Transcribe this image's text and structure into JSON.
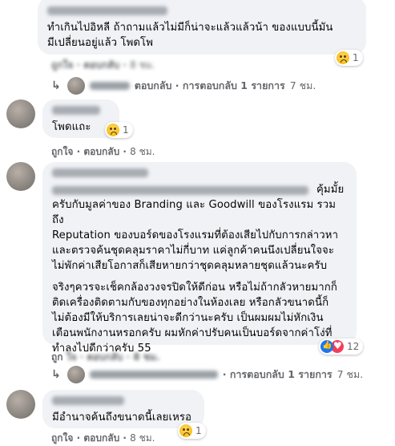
{
  "comments": [
    {
      "text": "ทำเกินไปอิหลี ถ้าถามแล้วไม่มีก็น่าจะแล้วแล้วน้า ของแบบนี้มัน\nมีเปลี่ยนอยู่แล้ว โพดโพ",
      "reaction_count": "1",
      "actions": {
        "like": "ถูกใจ",
        "reply": "ตอบกลับ",
        "time": "8 ชม."
      },
      "reply_summary": {
        "label": "ตอบกลับ · การตอบกลับ 1 รายการ",
        "time": "7 ชม."
      }
    },
    {
      "text": "โพดแถะ",
      "reaction_count": "1",
      "actions": {
        "like": "ถูกใจ",
        "reply": "ตอบกลับ",
        "time": "8 ชม."
      }
    },
    {
      "text_first_line_end": "คุ้มมั้ย",
      "text": "ครับกับมูลค่าของ Branding และ Goodwill ของโรงแรม รวมถึง\nReputation ของบอร์ดของโรงแรมที่ต้องเสียไปกับการกล่าวหา\nและตรวจค้นชุดคลุมราคาไม่กี่บาท แค่ลูกค้าคนนึงเปลี่ยนใจจะ\nไม่พักค่าเสียโอกาสก็เสียหายกว่าชุดคลุมหลายชุดแล้วนะครับ",
      "text2": "จริงๆควรจะเช็คกล้องวงจรปิดให้ดีก่อน หรือไม่ถ้ากลัวหายมากก็\nติดเครื่องติดตามกับของทุกอย่างในห้องเลย หรือกลัวขนาดนี้ก็\nไม่ต้องมีให้บริการเลยน่าจะดีกว่านะครับ เป็นผมผมไม่หักเงิน\nเตือนพนักงานหรอกครับ ผมหักค่าปรับคนเป็นบอร์ดจากค่าโง่ที่\nทำลงไปดีกว่าครับ 55",
      "reaction_count": "12",
      "actions": {
        "like": "ถูก",
        "time": "8 ชม."
      },
      "reply_summary": {
        "label": "· การตอบกลับ 1 รายการ",
        "time": "7 ชม."
      }
    },
    {
      "text": "มีอำนาจค้นถึงขนาดนี้เลยเหรอ",
      "reaction_count": "1",
      "actions": {
        "like": "ถูกใจ",
        "reply": "ตอบกลับ",
        "time": "8 ชม."
      }
    }
  ],
  "icons": {
    "reaction_sad": "sad-reaction-icon",
    "reaction_like": "like-reaction-icon",
    "reaction_love": "love-reaction-icon",
    "reply_arrow": "reply-arrow-icon"
  },
  "colors": {
    "bubble": "#f0f2f5",
    "secondary_text": "#65676b",
    "like_blue": "#1877f2",
    "love_red": "#f33e58"
  }
}
